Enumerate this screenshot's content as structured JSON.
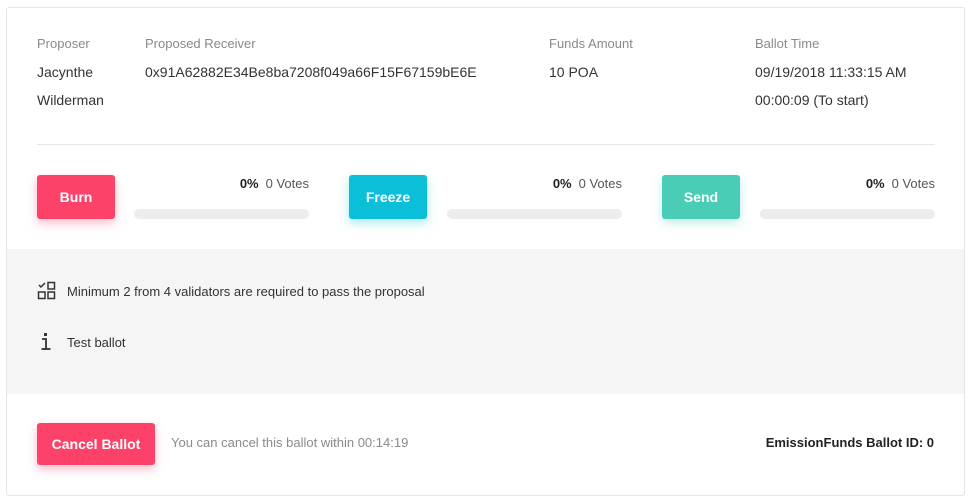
{
  "header": {
    "proposer_label": "Proposer",
    "proposer_line1": "Jacynthe",
    "proposer_line2": "Wilderman",
    "receiver_label": "Proposed Receiver",
    "receiver_value": "0x91A62882E34Be8ba7208f049a66F15F67159bE6E",
    "funds_label": "Funds Amount",
    "funds_value": "10 POA",
    "time_label": "Ballot Time",
    "time_value": "09/19/2018 11:33:15 AM",
    "time_remaining": "00:00:09 (To start)"
  },
  "votes": [
    {
      "label": "Burn",
      "percent_text": "0%",
      "count_text": "0 Votes",
      "progress": 0,
      "color": "#fc4268"
    },
    {
      "label": "Freeze",
      "percent_text": "0%",
      "count_text": "0 Votes",
      "progress": 0,
      "color": "#0bbfd9"
    },
    {
      "label": "Send",
      "percent_text": "0%",
      "count_text": "0 Votes",
      "progress": 0,
      "color": "#49cdb6"
    }
  ],
  "panel": {
    "requirement_icon": "validators-grid-icon",
    "requirement_text": "Minimum 2 from 4 validators are required to pass the proposal",
    "description_icon": "info-icon",
    "description_text": "Test ballot"
  },
  "footer": {
    "cancel_label": "Cancel Ballot",
    "cancel_note": "You can cancel this ballot within 00:14:19",
    "ballot_id": "EmissionFunds Ballot ID: 0"
  },
  "colors": {
    "burn": "#fc4268",
    "freeze": "#0bbfd9",
    "send": "#49cdb6",
    "panel_bg": "#f5f5f5"
  }
}
